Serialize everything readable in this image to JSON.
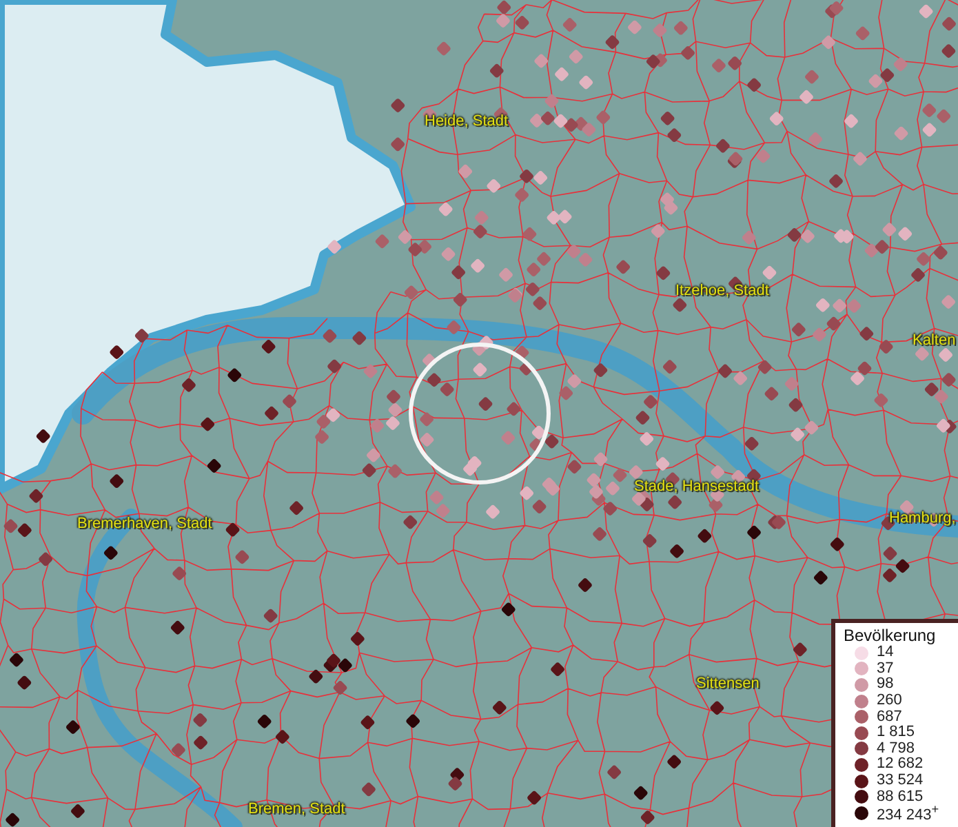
{
  "map": {
    "place_labels": [
      {
        "text": "Heide, Stadt"
      },
      {
        "text": "Itzehoe, Stadt"
      },
      {
        "text": "Kalten"
      },
      {
        "text": "Bremerhaven, Stadt"
      },
      {
        "text": "Stade, Hansestadt"
      },
      {
        "text": "Hamburg,"
      },
      {
        "text": "Sittensen"
      },
      {
        "text": "Bremen, Stadt"
      }
    ]
  },
  "legend": {
    "title": "Bevölkerung",
    "items": [
      {
        "label": "14",
        "color": "#f6dce6"
      },
      {
        "label": "37",
        "color": "#e2b4c0"
      },
      {
        "label": "98",
        "color": "#d09aa6"
      },
      {
        "label": "260",
        "color": "#c0808c"
      },
      {
        "label": "687",
        "color": "#aa6068"
      },
      {
        "label": "1 815",
        "color": "#984a52"
      },
      {
        "label": "4 798",
        "color": "#843a42"
      },
      {
        "label": "12 682",
        "color": "#6e2228"
      },
      {
        "label": "33 524",
        "color": "#5a1418"
      },
      {
        "label": "88 615",
        "color": "#440c10"
      },
      {
        "label": "234 243$^{+}$",
        "color": "#2a0608"
      }
    ]
  }
}
